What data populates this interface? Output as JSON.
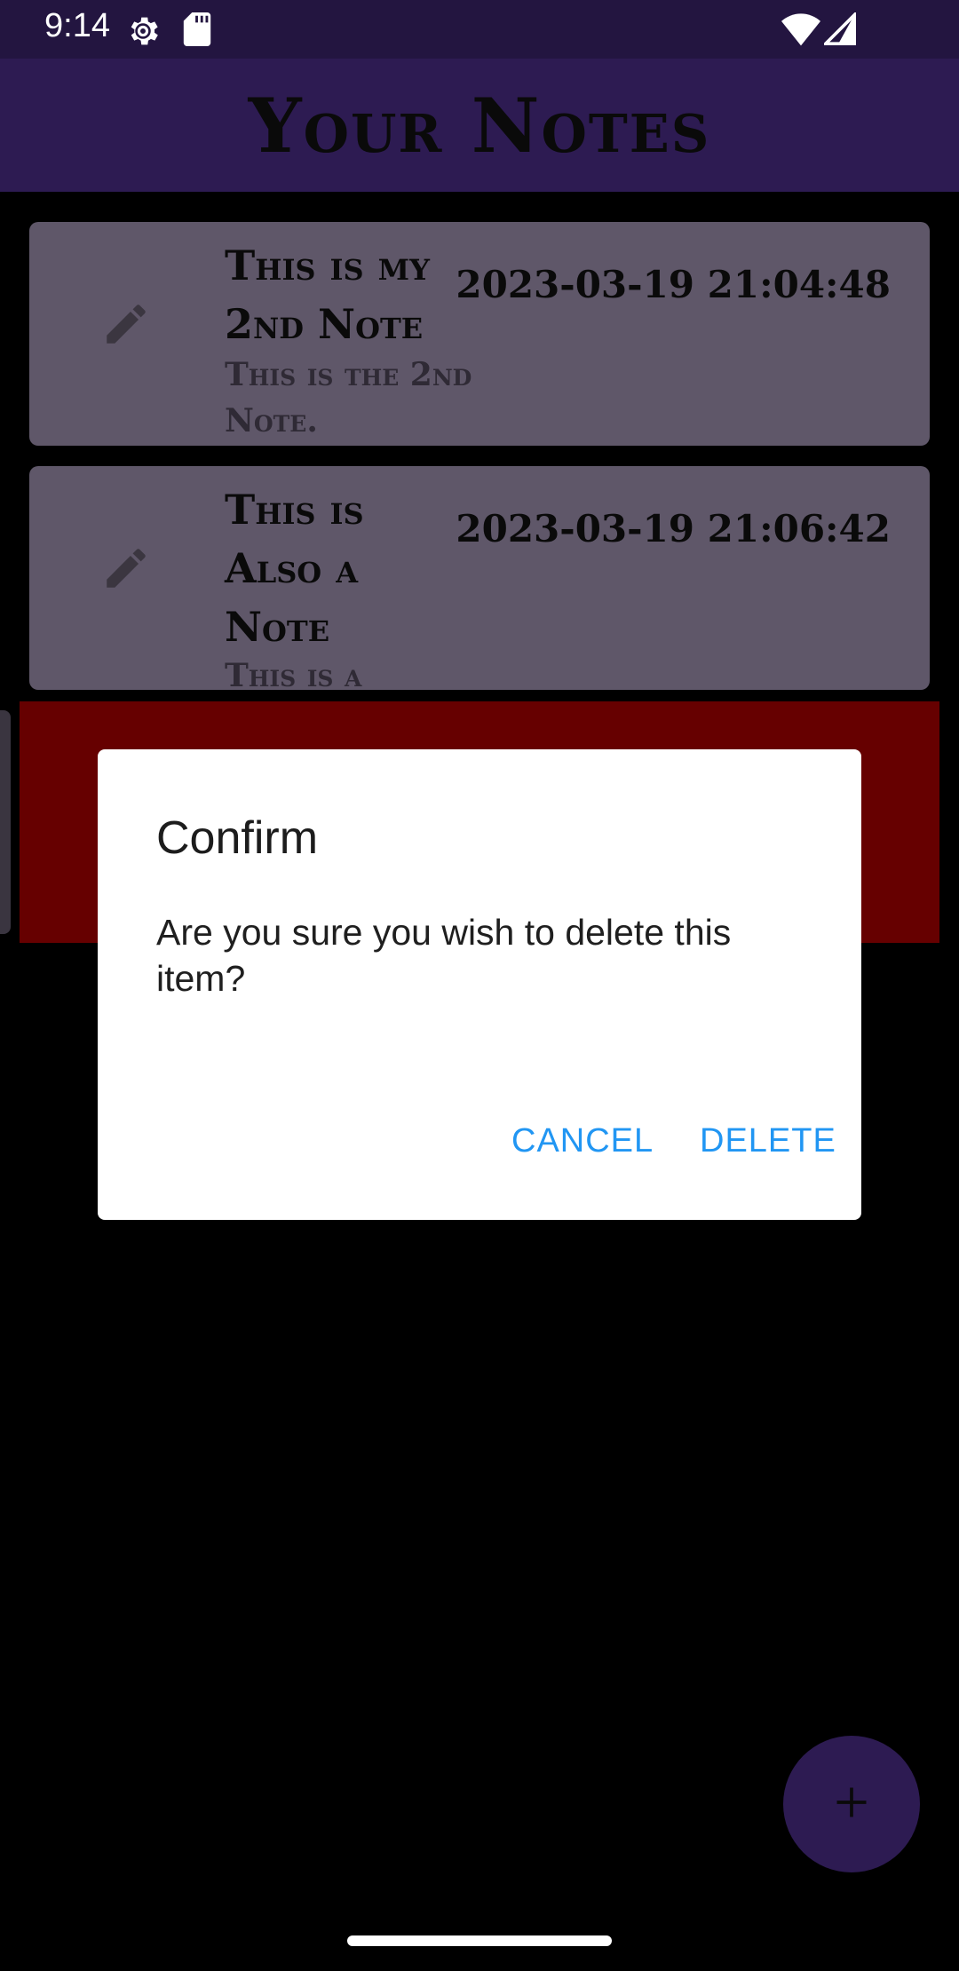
{
  "status_bar": {
    "time": "9:14",
    "icons": [
      "settings-gear-icon",
      "sd-card-icon",
      "wifi-icon",
      "cell-signal-icon"
    ]
  },
  "app_bar": {
    "title": "Your Notes"
  },
  "notes": [
    {
      "title": "This is my 2nd Note",
      "body": "This is the 2nd Note.",
      "date": "2023-03-19 21:04:48",
      "icon": "pencil-edit-icon"
    },
    {
      "title": "This is Also a Note",
      "body": "This is a",
      "date": "2023-03-19 21:06:42",
      "icon": "pencil-edit-icon"
    }
  ],
  "dialog": {
    "title": "Confirm",
    "message": "Are you sure you wish to delete this item?",
    "cancel_label": "CANCEL",
    "delete_label": "DELETE"
  },
  "fab": {
    "icon": "plus-icon"
  },
  "colors": {
    "status_bar": "#231540",
    "app_bar": "#2d1b52",
    "card": "#5f5769",
    "swipe_delete": "#660000",
    "dialog_button": "#2196f3"
  }
}
